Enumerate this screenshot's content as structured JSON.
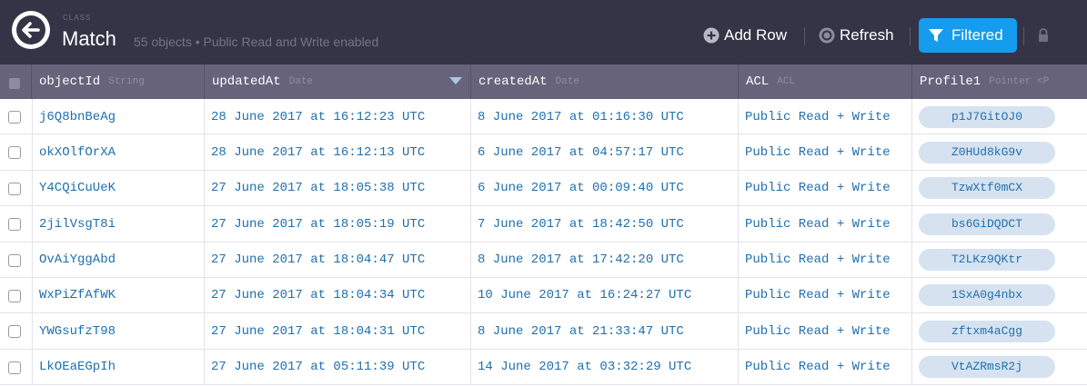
{
  "toolbar": {
    "back_icon": "back-arrow-icon",
    "class_caption": "CLASS",
    "class_name": "Match",
    "subtitle": "55 objects • Public Read and Write enabled",
    "add_row_label": "Add Row",
    "add_row_icon": "plus-circle-icon",
    "refresh_label": "Refresh",
    "refresh_icon": "refresh-icon",
    "filtered_label": "Filtered",
    "filtered_icon": "funnel-icon",
    "lock_icon": "lock-icon",
    "accent_color": "#169cee",
    "toolbar_color": "#353446"
  },
  "columns": [
    {
      "name": "objectId",
      "type": "String"
    },
    {
      "name": "updatedAt",
      "type": "Date"
    },
    {
      "name": "createdAt",
      "type": "Date"
    },
    {
      "name": "ACL",
      "type": "ACL"
    },
    {
      "name": "Profile1",
      "type": "Pointer <P"
    }
  ],
  "rows": [
    {
      "objectId": "j6Q8bnBeAg",
      "updatedAt": "28 June 2017 at 16:12:23 UTC",
      "createdAt": "8 June 2017 at 01:16:30 UTC",
      "acl": "Public Read + Write",
      "profile1": "p1J7GitOJ0"
    },
    {
      "objectId": "okXOlfOrXA",
      "updatedAt": "28 June 2017 at 16:12:13 UTC",
      "createdAt": "6 June 2017 at 04:57:17 UTC",
      "acl": "Public Read + Write",
      "profile1": "Z0HUd8kG9v"
    },
    {
      "objectId": "Y4CQiCuUeK",
      "updatedAt": "27 June 2017 at 18:05:38 UTC",
      "createdAt": "6 June 2017 at 00:09:40 UTC",
      "acl": "Public Read + Write",
      "profile1": "TzwXtf0mCX"
    },
    {
      "objectId": "2jilVsgT8i",
      "updatedAt": "27 June 2017 at 18:05:19 UTC",
      "createdAt": "7 June 2017 at 18:42:50 UTC",
      "acl": "Public Read + Write",
      "profile1": "bs6GiDQDCT"
    },
    {
      "objectId": "OvAiYggAbd",
      "updatedAt": "27 June 2017 at 18:04:47 UTC",
      "createdAt": "8 June 2017 at 17:42:20 UTC",
      "acl": "Public Read + Write",
      "profile1": "T2LKz9QKtr"
    },
    {
      "objectId": "WxPiZfAfWK",
      "updatedAt": "27 June 2017 at 18:04:34 UTC",
      "createdAt": "10 June 2017 at 16:24:27 UTC",
      "acl": "Public Read + Write",
      "profile1": "1SxA0g4nbx"
    },
    {
      "objectId": "YWGsufzT98",
      "updatedAt": "27 June 2017 at 18:04:31 UTC",
      "createdAt": "8 June 2017 at 21:33:47 UTC",
      "acl": "Public Read + Write",
      "profile1": "zftxm4aCgg"
    },
    {
      "objectId": "LkOEaEGpIh",
      "updatedAt": "27 June 2017 at 05:11:39 UTC",
      "createdAt": "14 June 2017 at 03:32:29 UTC",
      "acl": "Public Read + Write",
      "profile1": "VtAZRmsR2j"
    }
  ]
}
